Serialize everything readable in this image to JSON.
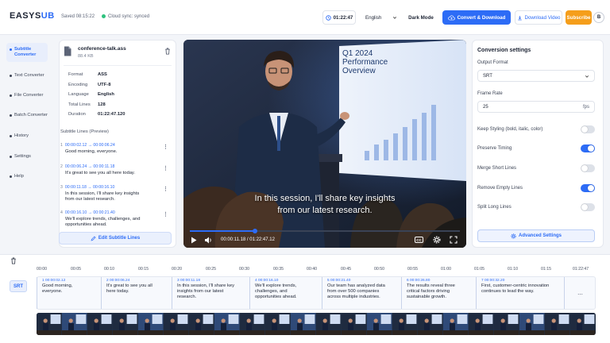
{
  "header": {
    "logo_left": "EASYS",
    "logo_right": "UB",
    "saved_text": "Saved 08:15:22",
    "cloud_text": "Cloud sync: synced",
    "timer": "01:22:47",
    "language": "English",
    "dark_mode_label": "Dark Mode",
    "convert_label": "Convert & Download",
    "download_label": "Download Video",
    "subscribe_label": "Subscribe",
    "avatar_initial": "B"
  },
  "sidebar": {
    "items": [
      {
        "label": "Subtitle Converter",
        "active": true
      },
      {
        "label": "Text Converter",
        "active": false
      },
      {
        "label": "File Converter",
        "active": false
      },
      {
        "label": "Batch Converter",
        "active": false
      },
      {
        "label": "History",
        "active": false
      },
      {
        "label": "Settings",
        "active": false
      },
      {
        "label": "Help",
        "active": false
      }
    ]
  },
  "file": {
    "name": "conference-talk.ass",
    "size": "88.4 KB",
    "info": [
      {
        "key": "Format",
        "value": "ASS"
      },
      {
        "key": "Encoding",
        "value": "UTF-8"
      },
      {
        "key": "Language",
        "value": "English"
      },
      {
        "key": "Total Lines",
        "value": "128"
      },
      {
        "key": "Duration",
        "value": "01:22:47.120"
      }
    ],
    "preview_title": "Subtitle Lines (Preview)",
    "lines": [
      {
        "num": "1",
        "start": "00:00:02.12",
        "end": "00:00:06.24",
        "text": "Good morning, everyone."
      },
      {
        "num": "2",
        "start": "00:00:06.24",
        "end": "00:00:11.18",
        "text": "It's great to see you all here today."
      },
      {
        "num": "3",
        "start": "00:00:11.18",
        "end": "00:00:16.10",
        "text": "In this session, I'll share key insights from our latest research."
      },
      {
        "num": "4",
        "start": "00:00:16.10",
        "end": "00:00:21.40",
        "text": "We'll explore trends, challenges, and opportunities ahead."
      }
    ],
    "edit_label": "Edit Subtitle Lines"
  },
  "video": {
    "slide_title_1": "Q1 2024",
    "slide_title_2": "Performance",
    "slide_title_3": "Overview",
    "caption_line_1": "In this session, I'll share key insights",
    "caption_line_2": "from our latest research.",
    "time_display": "00:00:11.18 / 01:22:47.12",
    "progress": 0.24,
    "cc_label": "CC"
  },
  "settings": {
    "title": "Conversion settings",
    "output_format_label": "Output Format",
    "output_format_value": "SRT",
    "frame_rate_label": "Frame Rate",
    "frame_rate_value": "25",
    "frame_rate_unit": "fps",
    "toggles": [
      {
        "label": "Keep Styling (bold, italic, color)",
        "on": false
      },
      {
        "label": "Preserve Timing",
        "on": true
      },
      {
        "label": "Merge Short Lines",
        "on": false
      },
      {
        "label": "Remove Empty Lines",
        "on": true
      },
      {
        "label": "Split Long Lines",
        "on": false
      }
    ],
    "advanced_label": "Advanced Settings"
  },
  "timeline": {
    "track_label": "SRT",
    "ticks": [
      "00:00",
      "00:05",
      "00:10",
      "00:15",
      "00:20",
      "00:25",
      "00:30",
      "00:35",
      "00:40",
      "00:45",
      "00:50",
      "00:55",
      "01:00",
      "01:05",
      "01:10",
      "01:15",
      "01:22:47"
    ],
    "clips": [
      {
        "num": "1",
        "tc": "00:00:02.12",
        "text": "Good morning, everyone."
      },
      {
        "num": "2",
        "tc": "00:00:06.24",
        "text": "It's great to see you all here today."
      },
      {
        "num": "3",
        "tc": "00:00:11.18",
        "text": "In this session, I'll share key insights from our latest research."
      },
      {
        "num": "4",
        "tc": "00:00:16.10",
        "text": "We'll explore trends, challenges, and opportunities ahead."
      },
      {
        "num": "5",
        "tc": "00:00:21.40",
        "text": "Our team has analyzed data from over 500 companies across multiple industries."
      },
      {
        "num": "6",
        "tc": "00:00:26.80",
        "text": "The results reveal three critical factors driving sustainable growth."
      },
      {
        "num": "7",
        "tc": "00:00:32.20",
        "text": "First, customer-centric innovation continues to lead the way."
      }
    ],
    "more": "..."
  },
  "colors": {
    "accent": "#2d6cf6",
    "subscribe": "#f59e1b",
    "synced": "#2ec27e"
  }
}
